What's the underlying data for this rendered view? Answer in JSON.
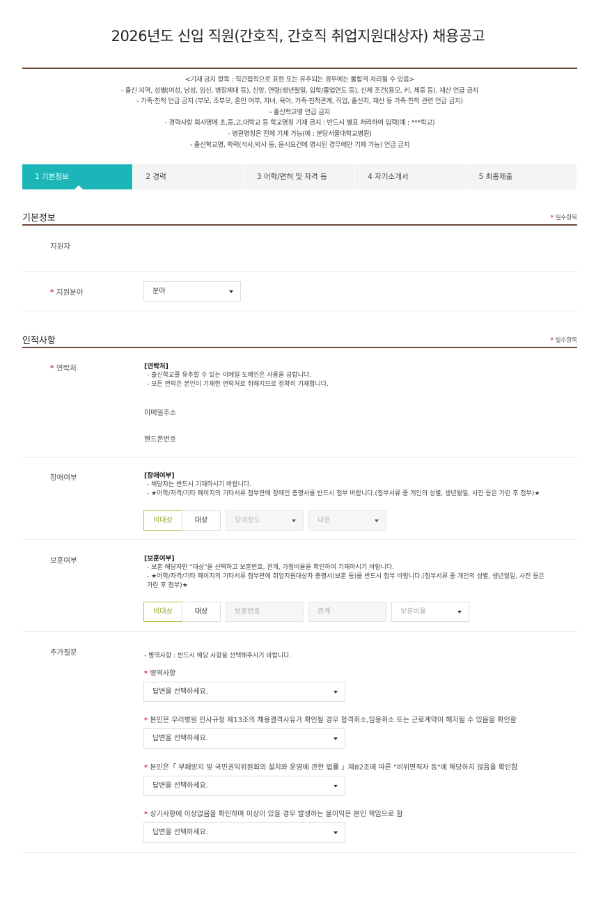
{
  "page_title": "2026년도 신입 직원(간호직, 간호직 취업지원대상자) 채용공고",
  "notice_lines": [
    "<기재 금지 항목 : 직간접적으로 표현 또는 유추되는 경우에는 불합격 처리될 수 있음>",
    "- 출신 지역, 성별(여성, 남성, 임신, 병장제대 등), 신앙, 연령(생년월일, 입학/졸업연도 등), 신체 조건(용모, 키, 체중 등), 재산 언급 금지",
    "- 가족·친척 언급 금지 (부모, 조부모, 혼인 여부, 자녀, 육아, 가족·친척관계, 직업, 출신지, 재산 등 가족·친척 관련 언급 금지)",
    "- 출신학교명 언급 금지",
    "- 경력사항 회사명에 초,중,고,대학교 등 학교명칭 기재 금지 : 반드시 별표 처리하여 입력(예 : ***학교)",
    "- 병원명칭은 전체 기재 가능(예 : 분당서울대학교병원)",
    "- 출신학교명, 학력(석사,박사 등, 응시요건에 명시된 경우에만 기재 가능) 언급 금지"
  ],
  "steps": [
    "1  기본정보",
    "2  경력",
    "3  어학/면허 및 자격 등",
    "4  자기소개서",
    "5  최종제출"
  ],
  "required_mark": "*",
  "required_note": "필수항목",
  "basic": {
    "title": "기본정보",
    "applicant_label": "지원자",
    "field_label": "지원분야",
    "field_select": "분야"
  },
  "personal": {
    "title": "인적사항",
    "contact": {
      "label": "연락처",
      "guide_title": "[연락처]",
      "guide_lines": [
        "- 출신학교를 유추할 수 있는 이메일 도메인은 사용을 금합니다.",
        "- 모든 연락은 본인이 기재한 연락처로 취해지므로 정확히 기재합니다."
      ],
      "email_label": "이메일주소",
      "phone_label": "핸드폰번호"
    },
    "disability": {
      "label": "장애여부",
      "guide_title": "[장애여부]",
      "guide_lines": [
        "- 해당자는 반드시 기재하시기 바랍니다.",
        "- ★어학/자격/기타 페이지의 기타서류 첨부란에 장애인 증명서를 반드시 첨부 바랍니다.(첨부서류 중 개인의 성별, 생년월일, 사진 등은 가린 후 첨부)★"
      ],
      "btn_no": "비대상",
      "btn_yes": "대상",
      "select_degree": "장애정도",
      "select_content": "내용"
    },
    "veteran": {
      "label": "보훈여부",
      "guide_title": "[보훈여부]",
      "guide_lines": [
        "- 보훈 해당자만 \"대상\"을 선택하고 보훈번호, 관계, 가점비율을 확인하여 기재하시기 바랍니다.",
        "- ★어학/자격/기타 페이지의 기타서류 첨부란에 취업지원대상자 증명서(보훈 등)를 반드시 첨부 바랍니다.(첨부서류 중 개인의 성별, 생년월일, 사진 등은",
        "가린 후 첨부)★"
      ],
      "btn_no": "비대상",
      "btn_yes": "대상",
      "input_number": "보훈번호",
      "input_relation": "관계",
      "select_ratio": "보훈비율"
    },
    "extra": {
      "label": "추가질문",
      "guide": "- 병역사항 : 반드시 해당 사항을 선택해주시기 바랍니다.",
      "questions": [
        {
          "label": "병역사항",
          "answer": "답변을 선택하세요."
        },
        {
          "label": "본인은 우리병원 인사규정 제13조의 채용결격사유가 확인될 경우 합격취소,임용취소 또는 근로계약이 해지될 수 있음을 확인함",
          "answer": "답변을 선택하세요."
        },
        {
          "label": "본인은「 부패방지 및 국민권익위원회의 설치와 운영에 관한 법률 」제82조에 따른 \"비위면직자 등\"에 해당하지 않음을 확인함",
          "answer": "답변을 선택하세요."
        },
        {
          "label": "상기사항에 이상없음을 확인하며 이상이 있을 경우 발생하는 불이익은 본인 책임으로 함",
          "answer": "답변을 선택하세요."
        }
      ]
    }
  }
}
